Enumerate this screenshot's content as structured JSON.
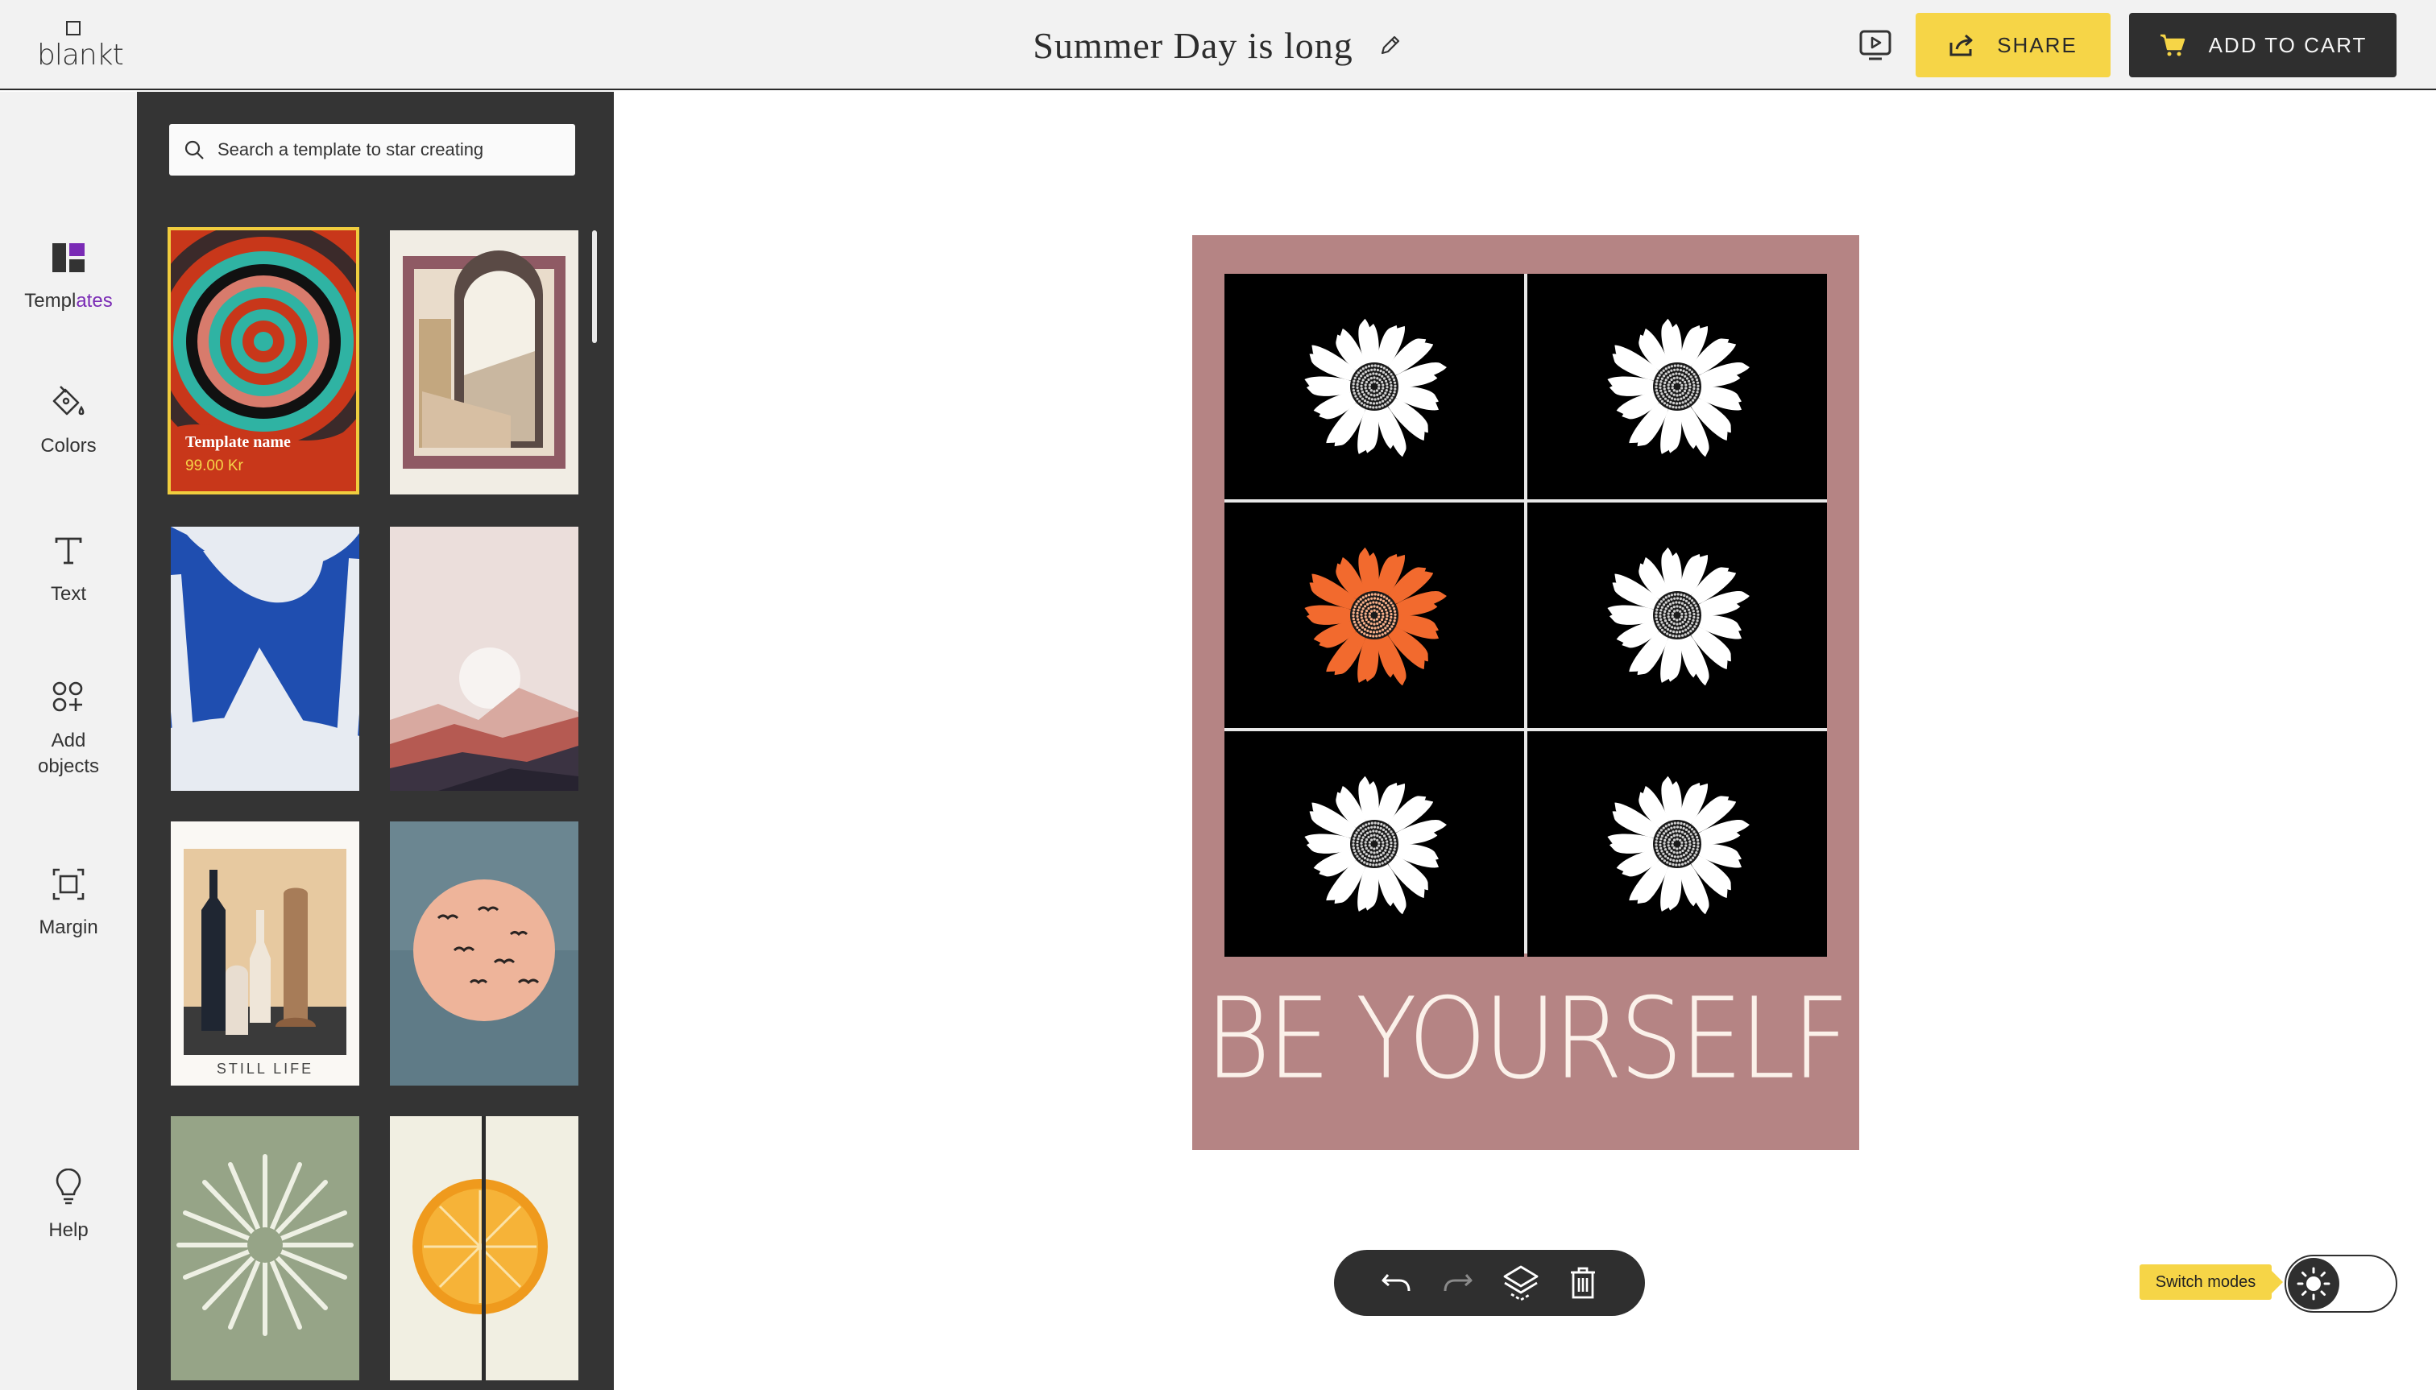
{
  "brand": {
    "name": "blankt"
  },
  "header": {
    "title": "Summer Day is long",
    "share_label": "SHARE",
    "cart_label": "ADD TO CART"
  },
  "sidebar": {
    "items": [
      {
        "label_main": "Templ",
        "label_accent": "ates",
        "icon": "templates-icon",
        "active": true
      },
      {
        "label": "Colors",
        "icon": "paint-bucket-icon"
      },
      {
        "label": "Text",
        "icon": "text-icon"
      },
      {
        "label": "Add objects",
        "icon": "add-objects-icon"
      },
      {
        "label": "Margin",
        "icon": "margin-icon"
      },
      {
        "label": "Help",
        "icon": "lightbulb-icon"
      }
    ]
  },
  "templates": {
    "search_placeholder": "Search a template to star creating",
    "selected": {
      "name": "Template name",
      "price": "99.00 Kr"
    },
    "still_life_caption": "STILL LIFE"
  },
  "canvas": {
    "slogan": "BE YOURSELF",
    "background": "#b58484",
    "flower_colors": [
      "#ffffff",
      "#ffffff",
      "#f26a2e",
      "#ffffff",
      "#ffffff",
      "#ffffff"
    ]
  },
  "toolbar": {
    "tools": [
      "undo-icon",
      "redo-icon",
      "layers-icon",
      "trash-icon"
    ]
  },
  "mode_switch": {
    "label": "Switch modes"
  },
  "colors": {
    "accent_yellow": "#f6d547",
    "dark": "#2f2f2f",
    "panel": "#343434",
    "purple_accent": "#7a2bb5"
  }
}
